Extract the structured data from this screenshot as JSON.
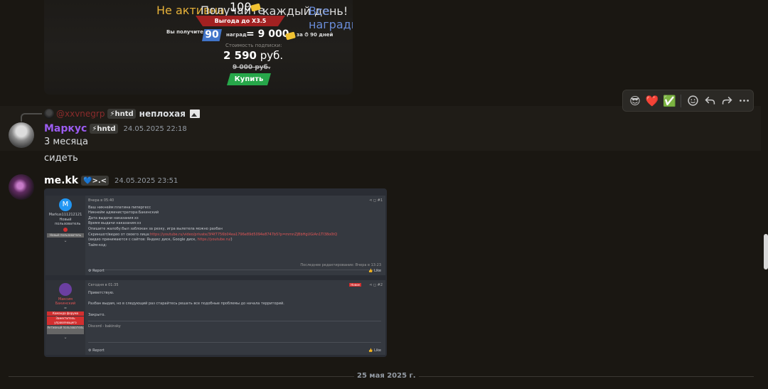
{
  "promo": {
    "inactive": "Не активна",
    "get_prefix": "Получайте",
    "amount": "100",
    "daily": "каждый день!",
    "all_rewards": "Все награды",
    "ribbon": "Выгода до Х3.5",
    "you_get": "Вы получите:",
    "days_num": "90",
    "award_word": "наград",
    "eq_total": "= 9 000",
    "for_days": "за ⏱ 90 дней",
    "cost_label": "Стоимость подписки:",
    "price_num": "2 590",
    "price_cur": " руб.",
    "old_price": "9 000 руб.",
    "buy": "Купить"
  },
  "toolbar": {
    "react1": "😎",
    "react2": "❤️",
    "react3": "✅"
  },
  "reply": {
    "name": "@xxvnegrp",
    "tag": "⚡hntd",
    "text": "неплохая"
  },
  "msg1": {
    "author": "Маркус",
    "tag": "⚡hntd",
    "timestamp": "24.05.2025 22:18",
    "line1": "3 месяца",
    "line2": "сидеть"
  },
  "msg2": {
    "author": "me.kk",
    "tag": "💙>.<",
    "timestamp": "24.05.2025 23:51"
  },
  "forum": {
    "p1": {
      "avatar_letter": "M",
      "user": "Markus111212121",
      "role": "Новый пользователь",
      "meta": "Вчера в 05:40",
      "lines": [
        "Ваш никнейм:платина пипергесс",
        "Никнейм администратора:Бакинский",
        "Дата выдачи наказания:хз",
        "Время выдачи наказания:хз",
        "Опишите жалобу:был заблокан за резку, игра вылетела можно разбан",
        "Скриншот/видео от своего лица:",
        "(видео принимаются с сайтов: Яндекс диск, Google диск, ",
        "Тайм-код:"
      ],
      "link1": "https://youtube.ru/video/private/3f4f7756b04ea1796e89d5094e8747b5?p=mmnZjBbHgUGiAn1Tl38o0tQ",
      "link2": "https://youtube.ru/",
      "edited": "Последнее редактирование: Вчера в 13:23",
      "report": "Report",
      "like": "Like"
    },
    "p2": {
      "user": "Максим Бакинский",
      "role1": "Команда форума",
      "role2": "Заместитель управляющего",
      "role3": "Активный пользователь",
      "meta": "Сегодня в 01:35",
      "tag": "Новое",
      "num": "#2",
      "lines": [
        "Приветствую.",
        "Разбан выдам, но в следующий раз старайтесь решать все подобные проблемы до начала территорий.",
        "Закрыто."
      ],
      "sig": "Discord - bakinsky",
      "report": "Report",
      "like": "Like"
    }
  },
  "date_divider": "25 мая 2025 г."
}
